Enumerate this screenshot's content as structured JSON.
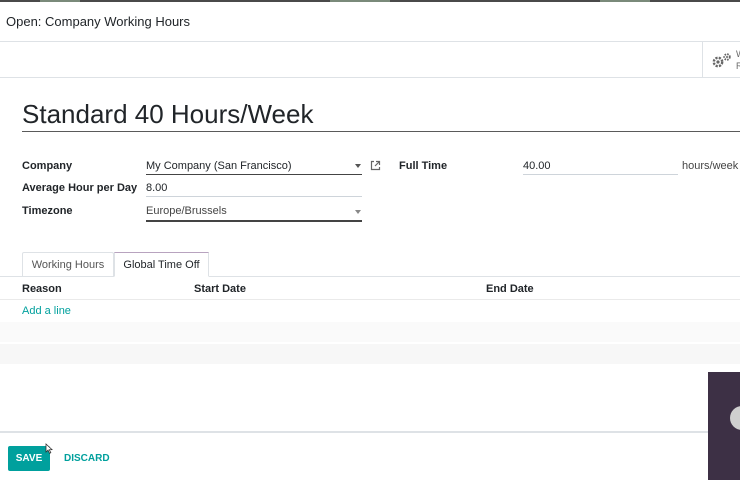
{
  "modal": {
    "title": "Open: Company Working Hours"
  },
  "smart_button": {
    "line1": "W",
    "line2": "R"
  },
  "record": {
    "name": "Standard 40 Hours/Week"
  },
  "fields": {
    "company": {
      "label": "Company",
      "value": "My Company (San Francisco)"
    },
    "avg_hours": {
      "label": "Average Hour per Day",
      "value": "8.00"
    },
    "timezone": {
      "label": "Timezone",
      "value": "Europe/Brussels"
    },
    "full_time": {
      "label": "Full Time",
      "value": "40.00",
      "unit": "hours/week"
    }
  },
  "tabs": [
    {
      "label": "Working Hours",
      "active": false
    },
    {
      "label": "Global Time Off",
      "active": true
    }
  ],
  "table": {
    "columns": [
      "Reason",
      "Start Date",
      "End Date"
    ],
    "add_line": "Add a line"
  },
  "footer": {
    "save_label": "SAVE",
    "discard_label": "DISCARD"
  },
  "colors": {
    "accent": "#00a09d",
    "text": "#212529",
    "border": "#dee2e6"
  }
}
